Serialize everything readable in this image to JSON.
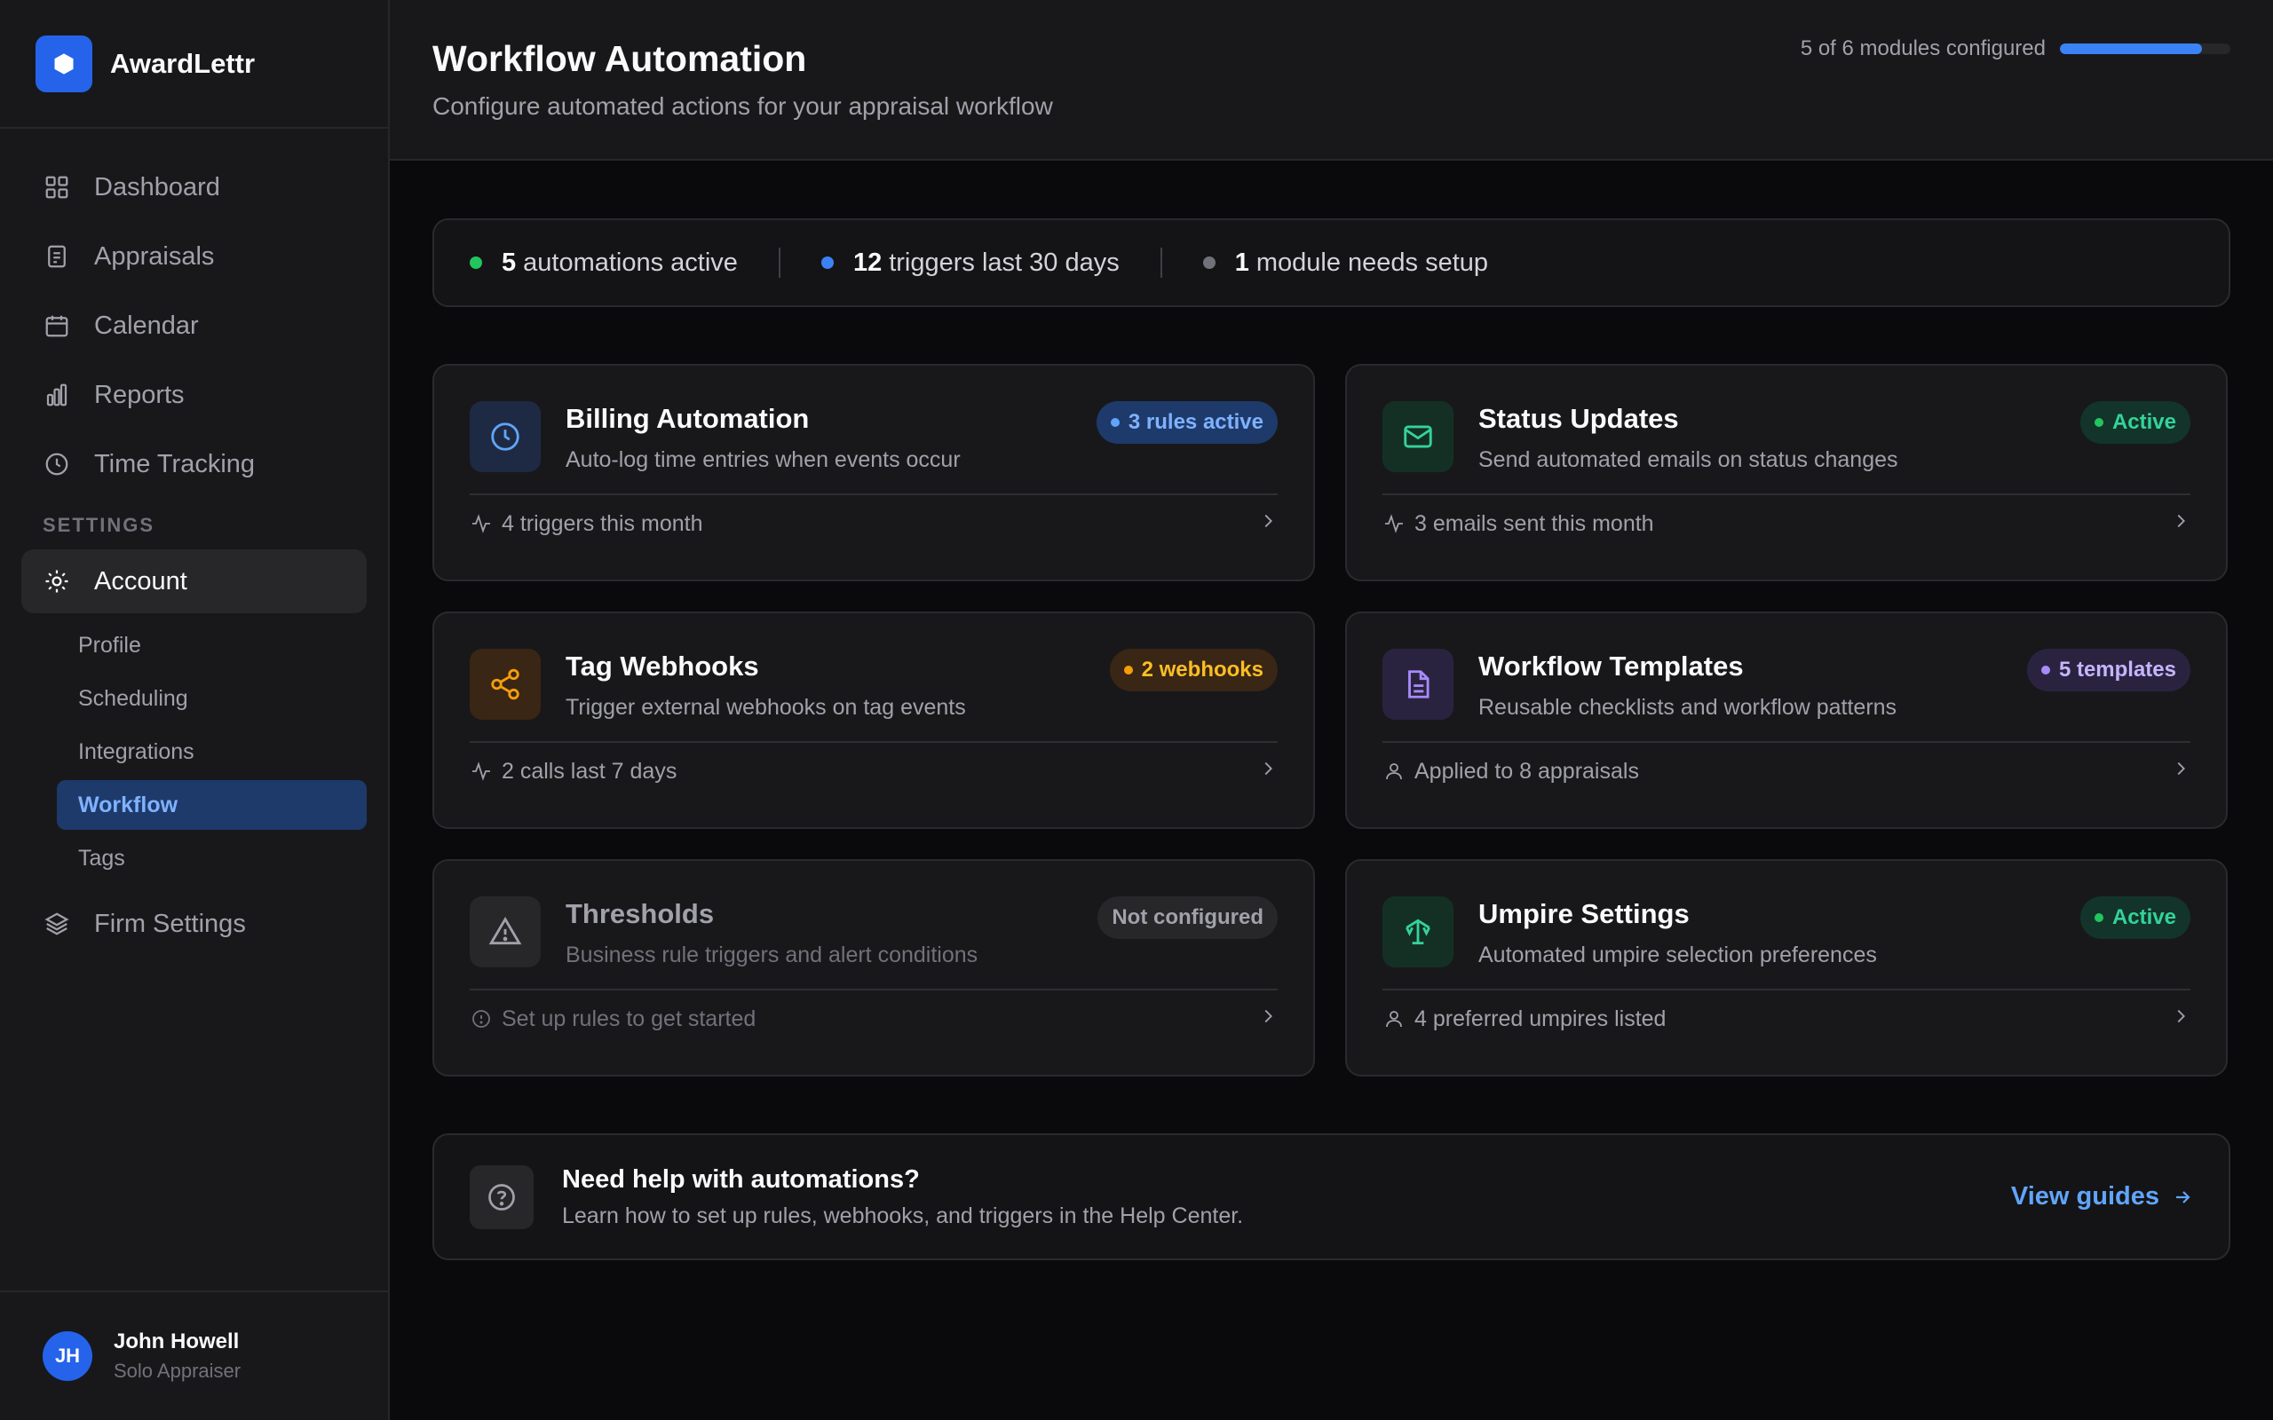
{
  "brand": {
    "name": "AwardLettr"
  },
  "nav": {
    "items": [
      {
        "label": "Dashboard",
        "icon": "grid-icon"
      },
      {
        "label": "Appraisals",
        "icon": "document-icon"
      },
      {
        "label": "Calendar",
        "icon": "calendar-icon"
      },
      {
        "label": "Reports",
        "icon": "bar-chart-icon"
      },
      {
        "label": "Time Tracking",
        "icon": "clock-icon"
      }
    ],
    "settings_label": "SETTINGS",
    "account_label": "Account",
    "sub_items": [
      "Profile",
      "Scheduling",
      "Integrations",
      "Workflow",
      "Tags"
    ],
    "active_sub": "Workflow",
    "firm_settings_label": "Firm Settings"
  },
  "user": {
    "initials": "JH",
    "name": "John Howell",
    "role": "Solo Appraiser"
  },
  "header": {
    "title": "Workflow Automation",
    "subtitle": "Configure automated actions for your appraisal workflow",
    "progress_text": "5 of 6 modules configured",
    "progress_fraction": 0.833
  },
  "stats": [
    {
      "value": "5",
      "label": "automations active",
      "color": "#22c55e"
    },
    {
      "value": "12",
      "label": "triggers last 30 days",
      "color": "#3b82f6"
    },
    {
      "value": "1",
      "label": "module needs setup",
      "color": "#71717a"
    }
  ],
  "cards": [
    {
      "title": "Billing Automation",
      "desc": "Auto-log time entries when events occur",
      "badge": "3 rules active",
      "footer": "4 triggers this month",
      "icon": "clock-icon",
      "footer_icon": "activity-icon"
    },
    {
      "title": "Status Updates",
      "desc": "Send automated emails on status changes",
      "badge": "Active",
      "footer": "3 emails sent this month",
      "icon": "mail-icon",
      "footer_icon": "activity-icon"
    },
    {
      "title": "Tag Webhooks",
      "desc": "Trigger external webhooks on tag events",
      "badge": "2 webhooks",
      "footer": "2 calls last 7 days",
      "icon": "share-icon",
      "footer_icon": "activity-icon"
    },
    {
      "title": "Workflow Templates",
      "desc": "Reusable checklists and workflow patterns",
      "badge": "5 templates",
      "footer": "Applied to 8 appraisals",
      "icon": "file-text-icon",
      "footer_icon": "user-icon"
    },
    {
      "title": "Thresholds",
      "desc": "Business rule triggers and alert conditions",
      "badge": "Not configured",
      "footer": "Set up rules to get started",
      "icon": "warning-triangle-icon",
      "footer_icon": "info-circle-icon"
    },
    {
      "title": "Umpire Settings",
      "desc": "Automated umpire selection preferences",
      "badge": "Active",
      "footer": "4 preferred umpires listed",
      "icon": "scale-icon",
      "footer_icon": "user-icon"
    }
  ],
  "help": {
    "title": "Need help with automations?",
    "desc": "Learn how to set up rules, webhooks, and triggers in the Help Center.",
    "link": "View guides"
  },
  "colors": {
    "accent": "#3b82f6",
    "green": "#22c55e",
    "amber": "#f59e0b",
    "purple": "#a78bfa"
  }
}
